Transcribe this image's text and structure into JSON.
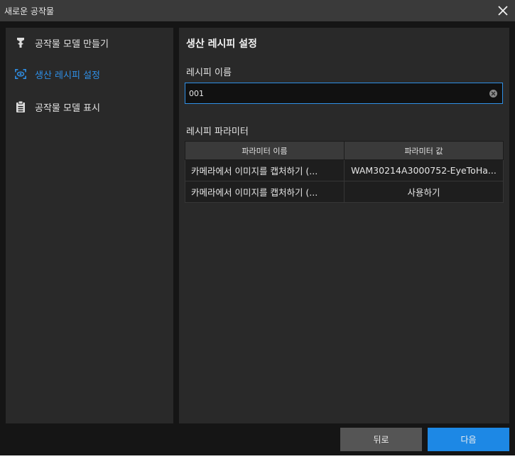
{
  "window": {
    "title": "새로운 공작물"
  },
  "sidebar": {
    "items": [
      {
        "label": "공작물 모델 만들기",
        "icon": "wrench-icon",
        "active": false
      },
      {
        "label": "생산 레시피 설정",
        "icon": "eye-scan-icon",
        "active": true
      },
      {
        "label": "공작물 모델 표시",
        "icon": "clipboard-icon",
        "active": false
      }
    ]
  },
  "main": {
    "title": "생산 레시피 설정",
    "recipe_name_label": "레시피 이름",
    "recipe_name_value": "001",
    "params_label": "레시피 파라미터",
    "table": {
      "headers": [
        "파라미터 이름",
        "파라미터 값"
      ],
      "rows": [
        [
          "카메라에서 이미지를 캡처하기 (...",
          "WAM30214A3000752-EyeToHa..."
        ],
        [
          "카메라에서 이미지를 캡처하기 (...",
          "사용하기"
        ]
      ]
    }
  },
  "footer": {
    "back_label": "뒤로",
    "next_label": "다음"
  },
  "colors": {
    "accent": "#1d88e5",
    "active_text": "#2f8fe6",
    "titlebar": "#3a3a3a",
    "panel": "#292929"
  }
}
